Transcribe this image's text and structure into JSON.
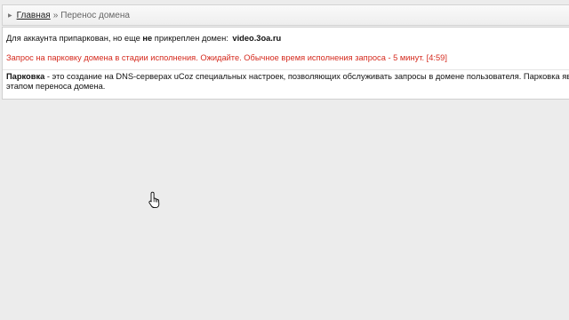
{
  "breadcrumb": {
    "home_label": "Главная",
    "separator": "»",
    "current_label": "Перенос домена"
  },
  "status": {
    "parked_text_1": "Для аккаунта припаркован, но еще",
    "parked_bold": "не",
    "parked_text_2": "прикреплен домен:",
    "domain": "video.3oa.ru"
  },
  "notice": {
    "text": "Запрос на парковку домена в стадии исполнения. Ожидайте. Обычное время исполнения запроса - 5 минут. [4:59]"
  },
  "info": {
    "term": "Парковка",
    "line1": " - это создание на DNS-серверах uCoz специальных настроек, позволяющих обслуживать запросы в домене пользователя. Парковка является",
    "line2": "этапом переноса домена."
  },
  "icons": {
    "breadcrumb_arrow": "triangle-right-icon",
    "cursor": "hand-pointer-icon"
  },
  "colors": {
    "notice": "#d52a1e",
    "background": "#ececec"
  }
}
